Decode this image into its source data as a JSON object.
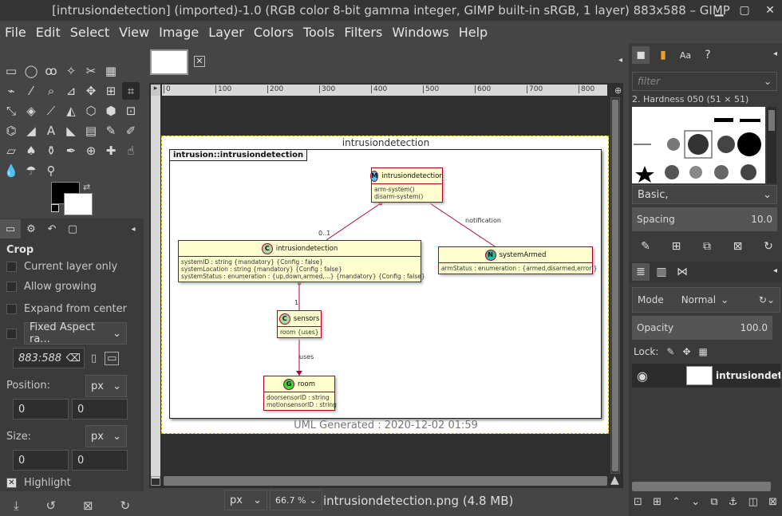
{
  "window": {
    "title": "[intrusiondetection] (imported)-1.0 (RGB color 8-bit gamma integer, GIMP built-in sRGB, 1 layer) 883x588 – GIMP"
  },
  "menu": [
    "File",
    "Edit",
    "Select",
    "View",
    "Image",
    "Layer",
    "Colors",
    "Tools",
    "Filters",
    "Windows",
    "Help"
  ],
  "tool_options": {
    "title": "Crop",
    "current_layer_only": "Current layer only",
    "allow_growing": "Allow growing",
    "expand_from_center": "Expand from center",
    "fixed_label": "Fixed Aspect ra...",
    "ratio_value": "883:588",
    "position_label": "Position:",
    "position_unit": "px",
    "position_x": "0",
    "position_y": "0",
    "size_label": "Size:",
    "size_unit": "px",
    "size_w": "0",
    "size_h": "0",
    "highlight": "Highlight"
  },
  "ruler_ticks": [
    "0",
    "100",
    "200",
    "300",
    "400",
    "500",
    "600",
    "700",
    "800"
  ],
  "diagram": {
    "title": "intrusiondetection",
    "package": "intrusion::intrusiondetection",
    "classes": {
      "main": {
        "badge": "M",
        "name": "intrusiondetection",
        "attrs": [
          "arm-system()",
          "disarm-system()"
        ]
      },
      "intr": {
        "badge": "C",
        "name": "intrusiondetection",
        "attrs": [
          "systemID : string    {mandatory} {Config : false}",
          "systemLocation : string    {mandatory} {Config : false}",
          "systemStatus : enumeration : {up,down,armed,...}    {mandatory} {Config : false}"
        ]
      },
      "armed": {
        "badge": "N",
        "name": "systemArmed",
        "attrs": [
          "armStatus : enumeration : {armed,disarmed,error,}"
        ]
      },
      "sensors": {
        "badge": "C",
        "name": "sensors",
        "attrs": [
          "room {uses}"
        ]
      },
      "room": {
        "badge": "G",
        "name": "room",
        "attrs": [
          "doorsensorID : string",
          "motionsensorID : string"
        ]
      }
    },
    "edge_labels": {
      "mult1": "0..1",
      "notification": "notification",
      "mult2": "1",
      "uses": "uses"
    },
    "footer": "UML Generated : 2020-12-02 01:59"
  },
  "status": {
    "unit": "px",
    "zoom": "66.7 %",
    "file": "intrusiondetection.png (4.8 MB)"
  },
  "brushes": {
    "filter_placeholder": "filter",
    "current": "2. Hardness 050 (51 × 51)",
    "preset": "Basic,",
    "spacing_label": "Spacing",
    "spacing_value": "10.0"
  },
  "layers": {
    "mode_label": "Mode",
    "mode_value": "Normal",
    "opacity_label": "Opacity",
    "opacity_value": "100.0",
    "lock_label": "Lock:",
    "layer_name": "intrusiondet"
  }
}
